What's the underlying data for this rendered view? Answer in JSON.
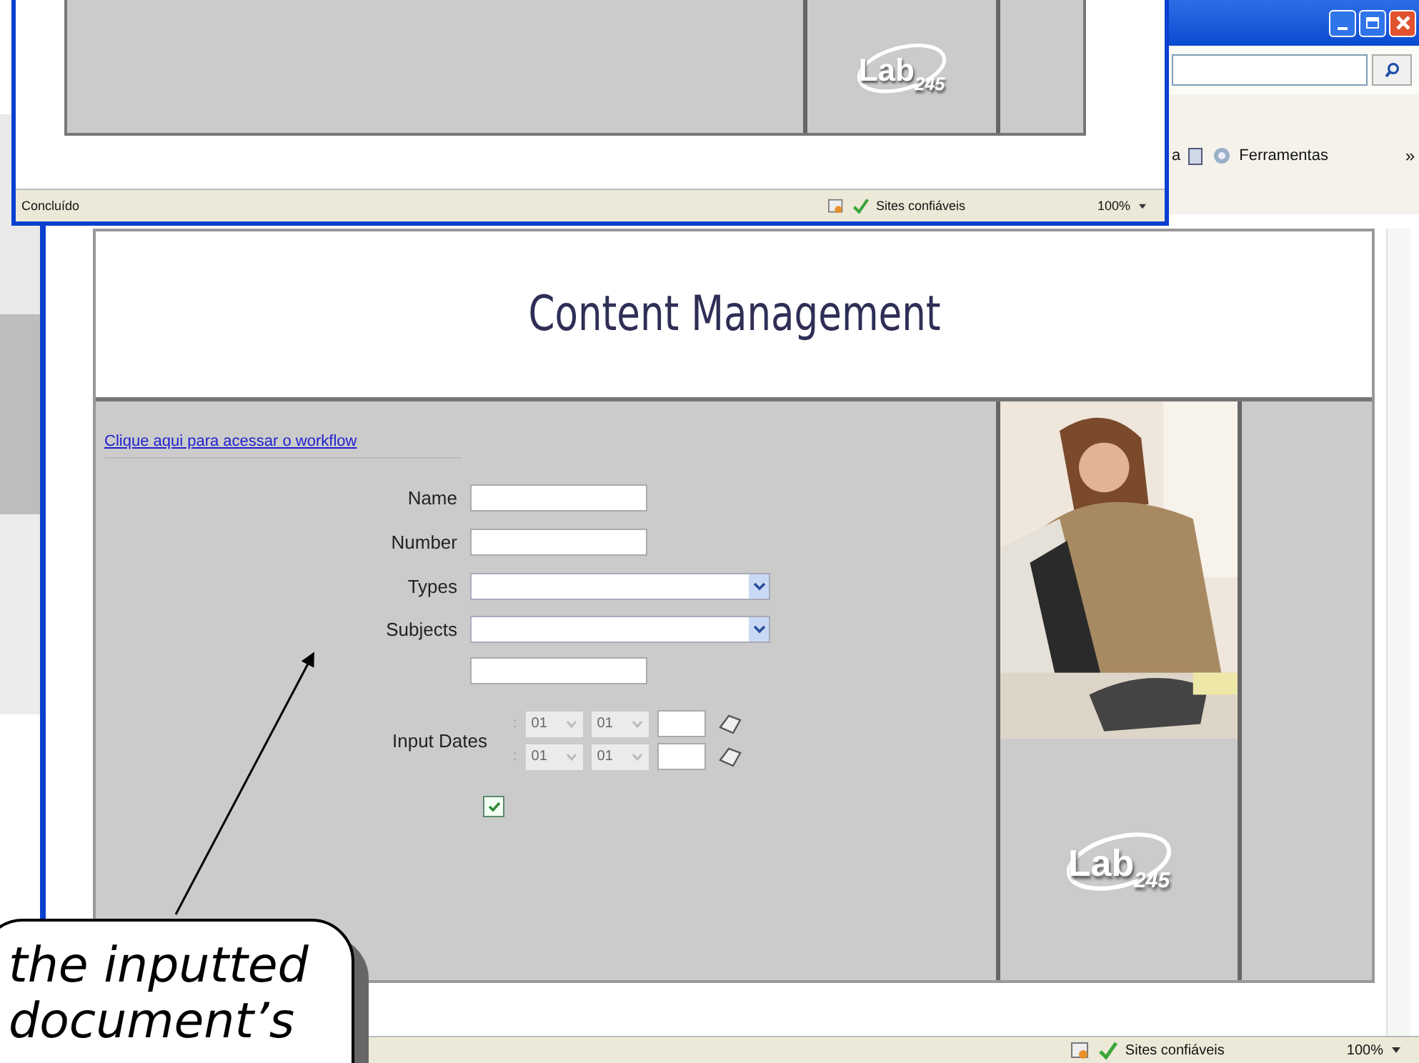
{
  "back_window": {
    "toolbar": {
      "items": [
        {
          "label": "a",
          "kind": "menu"
        },
        {
          "label": "Ferramentas",
          "kind": "tools"
        }
      ],
      "overflow": "»"
    }
  },
  "top_window": {
    "logo": {
      "name": "Lab",
      "number": "245"
    },
    "status_bar": {
      "status": "Concluído",
      "zone": "Sites confiáveis",
      "zoom": "100%"
    }
  },
  "main_window": {
    "page": {
      "title": "Content Management",
      "workflow_link": "Clique aqui para acessar o workflow",
      "form": {
        "fields": [
          {
            "kind": "text",
            "label": "Name"
          },
          {
            "kind": "text",
            "label": "Number"
          },
          {
            "kind": "select",
            "label": "Types"
          },
          {
            "kind": "select",
            "label": "Subjects"
          },
          {
            "kind": "text"
          }
        ],
        "input_dates": {
          "label": "Input Dates",
          "rows": [
            {
              "separator": ":",
              "day": "01",
              "month": "01"
            },
            {
              "separator": ":",
              "day": "01",
              "month": "01"
            }
          ]
        },
        "checkbox": {
          "checked": true
        }
      },
      "logo": {
        "name": "Lab",
        "number": "245"
      }
    },
    "status_bar": {
      "zone": "Sites confiáveis",
      "zoom": "100%"
    }
  },
  "callout": {
    "lines": [
      "the inputted",
      "document’s"
    ]
  }
}
